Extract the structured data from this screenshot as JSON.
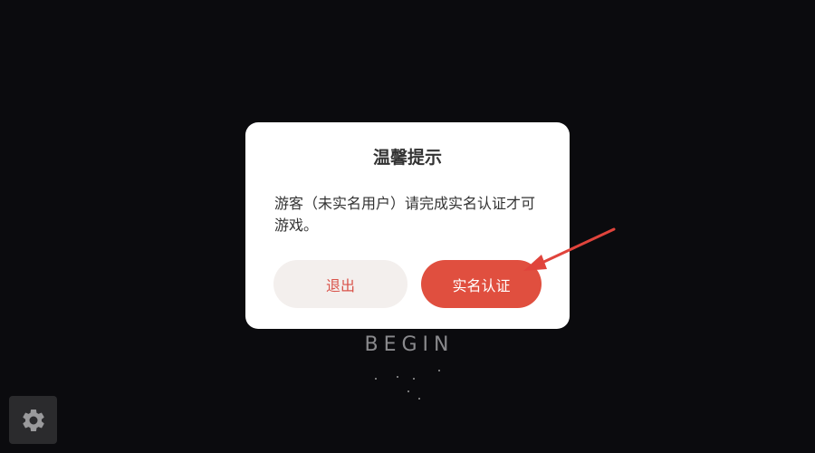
{
  "background": {
    "color": "#0b0b0e",
    "begin_label": "BEGIN"
  },
  "dialog": {
    "title": "温馨提示",
    "message": "游客（未实名用户）请完成实名认证才可游戏。",
    "exit_label": "退出",
    "verify_label": "实名认证",
    "accent_color": "#e04f3f"
  },
  "settings": {
    "icon": "gear-icon"
  },
  "annotation": {
    "icon": "arrow-icon",
    "color": "#e0443c"
  }
}
